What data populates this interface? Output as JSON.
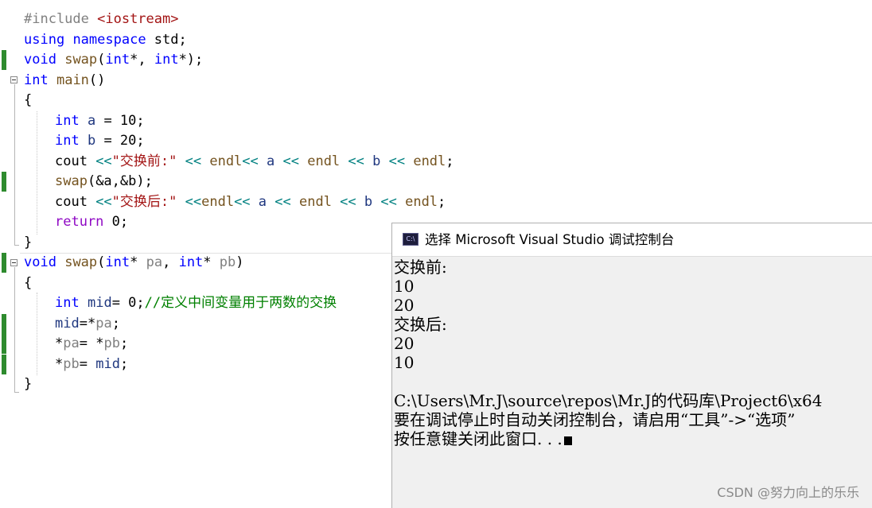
{
  "editor": {
    "lines": [
      [
        {
          "t": "#include ",
          "c": "pp"
        },
        {
          "t": "<iostream>",
          "c": "str"
        }
      ],
      [
        {
          "t": "using",
          "c": "kw"
        },
        {
          "t": " ",
          "c": "id"
        },
        {
          "t": "namespace",
          "c": "kw"
        },
        {
          "t": " std;",
          "c": "id"
        }
      ],
      [
        {
          "t": "void",
          "c": "kw"
        },
        {
          "t": " ",
          "c": "id"
        },
        {
          "t": "swap",
          "c": "fn"
        },
        {
          "t": "(",
          "c": "id"
        },
        {
          "t": "int",
          "c": "kw"
        },
        {
          "t": "*, ",
          "c": "id"
        },
        {
          "t": "int",
          "c": "kw"
        },
        {
          "t": "*);",
          "c": "id"
        }
      ],
      [
        {
          "t": "int",
          "c": "kw"
        },
        {
          "t": " ",
          "c": "id"
        },
        {
          "t": "main",
          "c": "fn"
        },
        {
          "t": "()",
          "c": "id"
        }
      ],
      [
        {
          "t": "{",
          "c": "id"
        }
      ],
      [
        {
          "t": "int",
          "c": "kw"
        },
        {
          "t": " ",
          "c": "id"
        },
        {
          "t": "a",
          "c": "var"
        },
        {
          "t": " = 10;",
          "c": "id"
        }
      ],
      [
        {
          "t": "int",
          "c": "kw"
        },
        {
          "t": " ",
          "c": "id"
        },
        {
          "t": "b",
          "c": "var"
        },
        {
          "t": " = 20;",
          "c": "id"
        }
      ],
      [
        {
          "t": "cout",
          "c": "id"
        },
        {
          "t": " <<",
          "c": "op"
        },
        {
          "t": "\"交换前:\"",
          "c": "str"
        },
        {
          "t": " << ",
          "c": "op"
        },
        {
          "t": "endl",
          "c": "fn"
        },
        {
          "t": "<< ",
          "c": "op"
        },
        {
          "t": "a",
          "c": "var"
        },
        {
          "t": " << ",
          "c": "op"
        },
        {
          "t": "endl",
          "c": "fn"
        },
        {
          "t": " << ",
          "c": "op"
        },
        {
          "t": "b",
          "c": "var"
        },
        {
          "t": " << ",
          "c": "op"
        },
        {
          "t": "endl",
          "c": "fn"
        },
        {
          "t": ";",
          "c": "id"
        }
      ],
      [
        {
          "t": "swap",
          "c": "fn"
        },
        {
          "t": "(&a,&b);",
          "c": "id"
        }
      ],
      [
        {
          "t": "cout",
          "c": "id"
        },
        {
          "t": " <<",
          "c": "op"
        },
        {
          "t": "\"交换后:\"",
          "c": "str"
        },
        {
          "t": " <<",
          "c": "op"
        },
        {
          "t": "endl",
          "c": "fn"
        },
        {
          "t": "<< ",
          "c": "op"
        },
        {
          "t": "a",
          "c": "var"
        },
        {
          "t": " << ",
          "c": "op"
        },
        {
          "t": "endl",
          "c": "fn"
        },
        {
          "t": " << ",
          "c": "op"
        },
        {
          "t": "b",
          "c": "var"
        },
        {
          "t": " << ",
          "c": "op"
        },
        {
          "t": "endl",
          "c": "fn"
        },
        {
          "t": ";",
          "c": "id"
        }
      ],
      [
        {
          "t": "return",
          "c": "kw2"
        },
        {
          "t": " 0;",
          "c": "id"
        }
      ],
      [
        {
          "t": "}",
          "c": "id"
        }
      ],
      [
        {
          "t": "void",
          "c": "kw"
        },
        {
          "t": " ",
          "c": "id"
        },
        {
          "t": "swap",
          "c": "fn"
        },
        {
          "t": "(",
          "c": "id"
        },
        {
          "t": "int",
          "c": "kw"
        },
        {
          "t": "* ",
          "c": "id"
        },
        {
          "t": "pa",
          "c": "par"
        },
        {
          "t": ", ",
          "c": "id"
        },
        {
          "t": "int",
          "c": "kw"
        },
        {
          "t": "* ",
          "c": "id"
        },
        {
          "t": "pb",
          "c": "par"
        },
        {
          "t": ")",
          "c": "id"
        }
      ],
      [
        {
          "t": "{",
          "c": "id"
        }
      ],
      [
        {
          "t": "int",
          "c": "kw"
        },
        {
          "t": " ",
          "c": "id"
        },
        {
          "t": "mid",
          "c": "var"
        },
        {
          "t": "= 0;",
          "c": "id"
        },
        {
          "t": "//定义中间变量用于两数的交换",
          "c": "cm"
        }
      ],
      [
        {
          "t": "mid",
          "c": "var"
        },
        {
          "t": "=*",
          "c": "id"
        },
        {
          "t": "pa",
          "c": "par"
        },
        {
          "t": ";",
          "c": "id"
        }
      ],
      [
        {
          "t": "*",
          "c": "id"
        },
        {
          "t": "pa",
          "c": "par"
        },
        {
          "t": "= *",
          "c": "id"
        },
        {
          "t": "pb",
          "c": "par"
        },
        {
          "t": ";",
          "c": "id"
        }
      ],
      [
        {
          "t": "*",
          "c": "id"
        },
        {
          "t": "pb",
          "c": "par"
        },
        {
          "t": "= ",
          "c": "id"
        },
        {
          "t": "mid",
          "c": "var"
        },
        {
          "t": ";",
          "c": "id"
        }
      ],
      [
        {
          "t": "}",
          "c": "id"
        }
      ]
    ]
  },
  "colors": {
    "keyword": "#0000ff",
    "control_keyword": "#8f08c4",
    "function": "#74531f",
    "string": "#a31515",
    "comment": "#008000",
    "operator": "#008080",
    "change_bar": "#2e8b2e"
  },
  "console": {
    "icon_text": "C:\\",
    "title": "选择 Microsoft Visual Studio 调试控制台",
    "lines": [
      "交换前:",
      "10",
      "20",
      "交换后:",
      "20",
      "10",
      "",
      "C:\\Users\\Mr.J\\source\\repos\\Mr.J的代码库\\Project6\\x64",
      "要在调试停止时自动关闭控制台，请启用“工具”->“选项”",
      "按任意键关闭此窗口. . ."
    ]
  },
  "watermark": "CSDN @努力向上的乐乐"
}
